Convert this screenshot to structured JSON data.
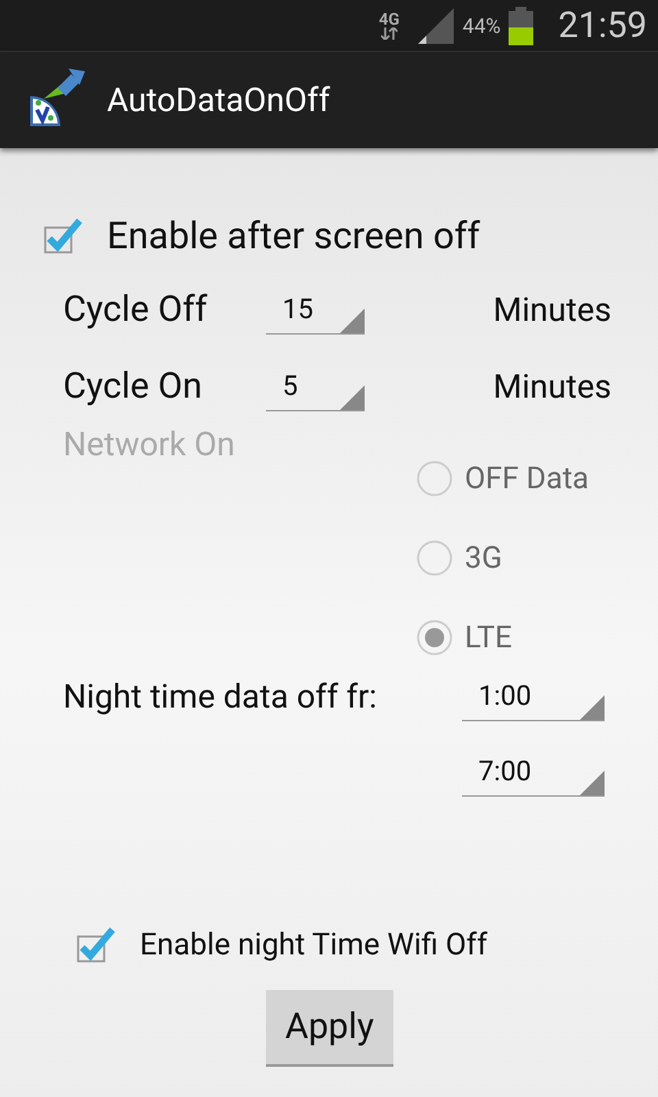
{
  "status_bar": {
    "network": "4G",
    "battery_text": "44%",
    "time": "21:59"
  },
  "app_bar": {
    "title": "AutoDataOnOff"
  },
  "enable_after_screen_off": {
    "label": "Enable after screen off",
    "checked": true
  },
  "cycles": [
    {
      "label": "Cycle Off",
      "value": "15",
      "unit": "Minutes"
    },
    {
      "label": "Cycle On",
      "value": "5",
      "unit": "Minutes"
    }
  ],
  "network_on": {
    "label": "Network On",
    "disabled": true,
    "options": [
      {
        "label": "OFF Data",
        "selected": false
      },
      {
        "label": "3G",
        "selected": false
      },
      {
        "label": "LTE",
        "selected": true
      }
    ]
  },
  "night_time": {
    "label": "Night time data off fr:",
    "from": "1:00",
    "to": "7:00"
  },
  "wifi_off": {
    "label": "Enable night Time Wifi Off",
    "checked": true
  },
  "apply_button": "Apply"
}
